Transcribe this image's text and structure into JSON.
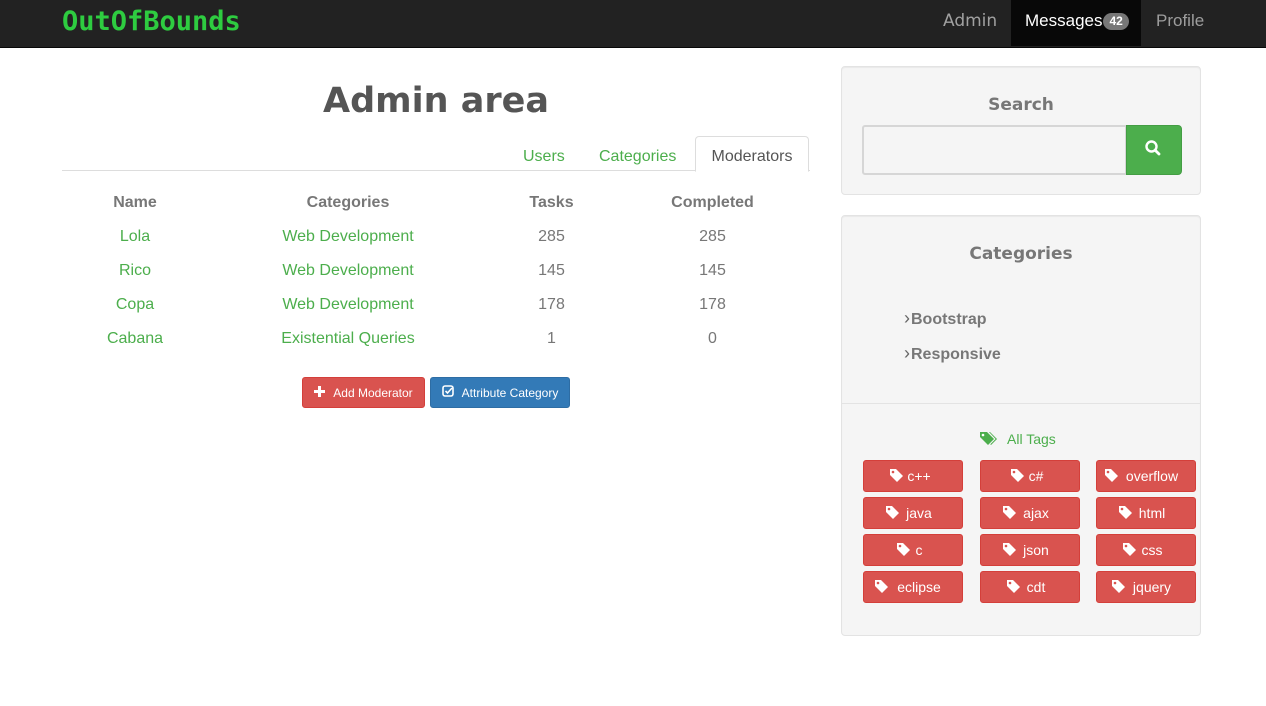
{
  "navbar": {
    "brand": "OutOfBounds",
    "admin": "Admin",
    "messages": "Messages",
    "messages_count": "42",
    "profile": "Profile"
  },
  "main": {
    "title": "Admin area",
    "tabs": [
      {
        "label": "Users"
      },
      {
        "label": "Categories"
      },
      {
        "label": "Moderators",
        "active": true
      }
    ],
    "table": {
      "headers": [
        "Name",
        "Categories",
        "Tasks",
        "Completed"
      ],
      "rows": [
        {
          "name": "Lola",
          "category": "Web Development",
          "tasks": "285",
          "completed": "285"
        },
        {
          "name": "Rico",
          "category": "Web Development",
          "tasks": "145",
          "completed": "145"
        },
        {
          "name": "Copa",
          "category": "Web Development",
          "tasks": "178",
          "completed": "178"
        },
        {
          "name": "Cabana",
          "category": "Existential Queries",
          "tasks": "1",
          "completed": "0"
        }
      ]
    },
    "buttons": {
      "add_moderator": "Add Moderator",
      "attribute_category": "Attribute Category"
    }
  },
  "sidebar": {
    "search": {
      "heading": "Search",
      "value": "",
      "button_icon": "search-icon"
    },
    "categories": {
      "heading": "Categories",
      "items": [
        "Bootstrap",
        "Responsive"
      ],
      "all_tags": "All Tags",
      "tags": [
        "c++",
        "c#",
        "overflow",
        "java",
        "ajax",
        "html",
        "c",
        "json",
        "css",
        "eclipse",
        "cdt",
        "jquery"
      ]
    }
  },
  "colors": {
    "navbar_bg": "#222222",
    "brand": "#2ecc40",
    "success": "#4cae4c",
    "danger": "#d9534f",
    "primary": "#337ab7"
  }
}
